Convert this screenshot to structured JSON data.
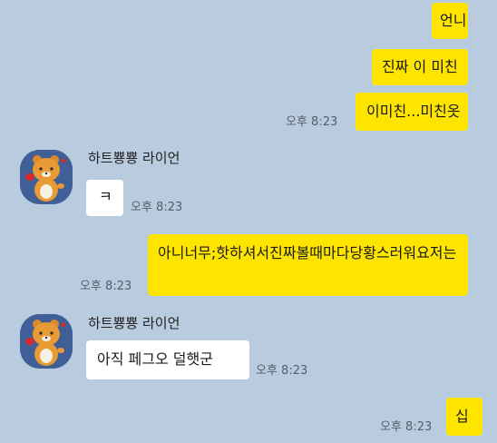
{
  "messages": [
    {
      "from": "me",
      "text": "언니"
    },
    {
      "from": "me",
      "text": "진짜 이 미친"
    },
    {
      "from": "me",
      "text": "이미친...미친옷",
      "time": "오후 8:23"
    },
    {
      "from": "other",
      "sender": "하트뿅뿅 라이언",
      "text": "ㅋ",
      "time": "오후 8:23",
      "avatar_icon": "ryan-character-icon"
    },
    {
      "from": "me",
      "text": "아니너무;핫하셔서진짜볼때마다당황스러워요저는",
      "time": "오후 8:23"
    },
    {
      "from": "other",
      "sender": "하트뿅뿅 라이언",
      "text": "아직 페그오 덜햇군",
      "time": "오후 8:23",
      "avatar_icon": "ryan-character-icon"
    },
    {
      "from": "me",
      "text": "십",
      "time": "오후 8:23"
    }
  ],
  "colors": {
    "background": "#b9cbdf",
    "my_bubble": "#fee500",
    "other_bubble": "#ffffff",
    "avatar_bg": "#3f5f96"
  }
}
